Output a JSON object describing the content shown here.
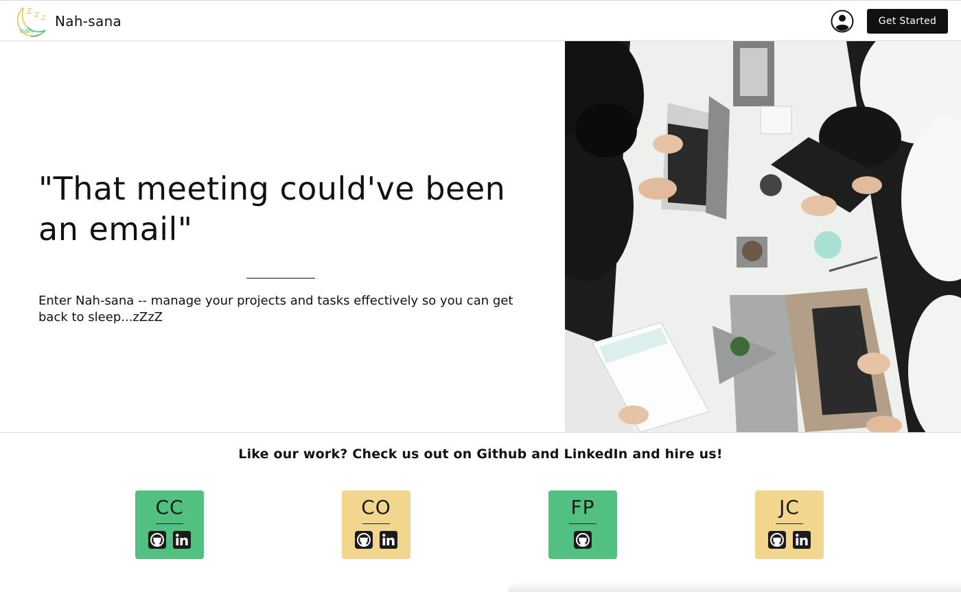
{
  "header": {
    "brand_name": "Nah-sana",
    "logo_text": "nah",
    "logo_z_text": "Z",
    "cta_label": "Get Started"
  },
  "hero": {
    "quote": "\"That meeting could've been an email\"",
    "tagline": "Enter Nah-sana -- manage your projects and tasks effectively so you can get back to sleep...zZzZ"
  },
  "team": {
    "heading": "Like our work? Check us out on Github and LinkedIn and hire us!",
    "members": [
      {
        "initials": "CC",
        "color": "#52c080",
        "links": [
          "github-icon",
          "linkedin-icon"
        ]
      },
      {
        "initials": "CO",
        "color": "#f2d68d",
        "links": [
          "github-icon",
          "linkedin-icon"
        ]
      },
      {
        "initials": "FP",
        "color": "#52c080",
        "links": [
          "github-icon"
        ]
      },
      {
        "initials": "JC",
        "color": "#f2d68d",
        "links": [
          "github-icon",
          "linkedin-icon"
        ]
      }
    ]
  },
  "colors": {
    "green": "#52c080",
    "yellow": "#f2d68d",
    "dark": "#111111",
    "logo_gold": "#e8c44a",
    "logo_teal": "#52c080"
  }
}
